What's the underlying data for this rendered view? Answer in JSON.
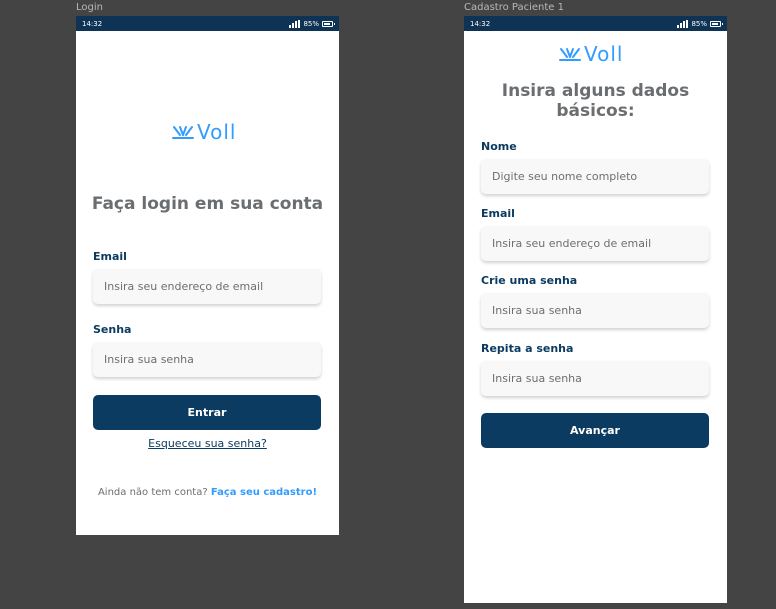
{
  "login": {
    "frame_label": "Login",
    "status": {
      "time": "14:32",
      "battery": "85%"
    },
    "brand": "Voll",
    "title": "Faça login em sua conta",
    "email_label": "Email",
    "email_placeholder": "Insira seu endereço de email",
    "password_label": "Senha",
    "password_placeholder": "Insira sua senha",
    "submit_label": "Entrar",
    "forgot_link": "Esqueceu sua senha?",
    "signup_prompt": "Ainda não tem conta?",
    "signup_link": "Faça seu cadastro!"
  },
  "register": {
    "frame_label": "Cadastro Paciente 1",
    "status": {
      "time": "14:32",
      "battery": "85%"
    },
    "brand": "Voll",
    "title_line1": "Insira alguns dados",
    "title_line2": "básicos:",
    "name_label": "Nome",
    "name_placeholder": "Digite seu nome completo",
    "email_label": "Email",
    "email_placeholder": "Insira seu endereço de email",
    "password_label": "Crie uma senha",
    "password_placeholder": "Insira sua senha",
    "repeat_label": "Repita a senha",
    "repeat_placeholder": "Insira sua senha",
    "next_label": "Avançar"
  },
  "colors": {
    "brand_blue": "#339cff",
    "primary_dark": "#0b3b60",
    "status_bar": "#0f3355",
    "canvas": "#444444"
  }
}
